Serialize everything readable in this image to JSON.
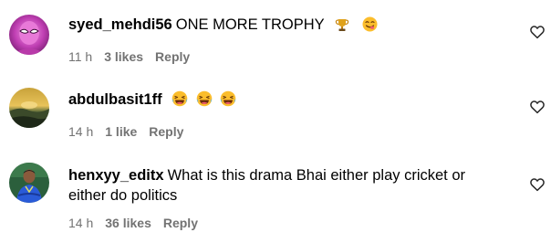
{
  "comments": [
    {
      "username": "syed_mehdi56",
      "text": "ONE MORE TROPHY",
      "emojis": [
        "trophy-emoji",
        "face-savoring-food-emoji"
      ],
      "time": "11 h",
      "likes": "3 likes",
      "reply": "Reply",
      "avatar": "pink-masked-hero-avatar"
    },
    {
      "username": "abdulbasit1ff",
      "text": "",
      "emojis": [
        "laughing-emoji",
        "laughing-emoji",
        "laughing-emoji"
      ],
      "time": "14 h",
      "likes": "1 like",
      "reply": "Reply",
      "avatar": "sunset-landscape-avatar"
    },
    {
      "username": "henxyy_editx",
      "text": "What is this drama Bhai either play cricket or",
      "text_line2": "either do politics",
      "time": "14 h",
      "likes": "36 likes",
      "reply": "Reply",
      "avatar": "cricketer-avatar"
    }
  ],
  "colors": {
    "meta": "#737373",
    "text": "#000000",
    "background": "#ffffff",
    "heart_stroke": "#262626"
  },
  "icons": {
    "like": "heart-outline-icon"
  }
}
